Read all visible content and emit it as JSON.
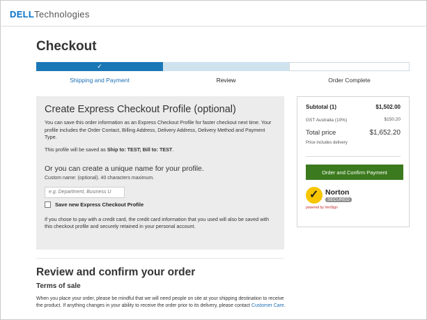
{
  "brand": {
    "dell": "DELL",
    "technologies": "Technologies"
  },
  "page": {
    "title": "Checkout"
  },
  "progress": {
    "done_mark": "✓"
  },
  "steps": [
    {
      "label": "Shipping and Payment"
    },
    {
      "label": "Review"
    },
    {
      "label": "Order Complete"
    }
  ],
  "express": {
    "title": "Create Express Checkout Profile (optional)",
    "intro": "You can save this order information as an Express Checkout Profile for faster checkout next time. Your profile includes the Order Contact, Billing Address, Delivery Address, Delivery Method and Payment Type.",
    "saved_as_prefix": "This profile will be saved as ",
    "saved_as_value": "Ship to: TEST; Bill to: TEST",
    "saved_as_suffix": ".",
    "unique_heading": "Or you can create a unique name for your profile.",
    "custom_label": "Custom name: (optional).",
    "custom_hint": "40 characters maximum.",
    "custom_placeholder": "e.g. Department, Business U",
    "save_label": "Save new Express Checkout Profile",
    "credit_note": "If you chose to pay with a credit card, the credit card information that you used will also be saved with this checkout profile and securely retained in your personal account."
  },
  "summary": {
    "subtotal_label": "Subtotal (1)",
    "subtotal_value": "$1,502.00",
    "gst_label": "GST Australia (10%)",
    "gst_value": "$150.20",
    "total_label": "Total price",
    "total_value": "$1,652.20",
    "includes_delivery": "Price includes delivery",
    "order_button": "Order and Confirm Payment",
    "norton_name": "Norton",
    "norton_secured": "SECURED",
    "powered_by": "powered by VeriSign"
  },
  "review": {
    "title": "Review and confirm your order",
    "terms_title": "Terms of sale",
    "terms_text": "When you place your order, please be mindful that we will need people on site at your shipping destination to receive the product. If anything changes in your ability to receive the order prior to its delivery, please contact ",
    "care_link": "Customer Care",
    "terms_end": "."
  },
  "colors": {
    "progress_done": "#1b78b7",
    "progress_current": "#cfe3ef",
    "order_button": "#3b7a1e",
    "link": "#1b6fb5"
  }
}
